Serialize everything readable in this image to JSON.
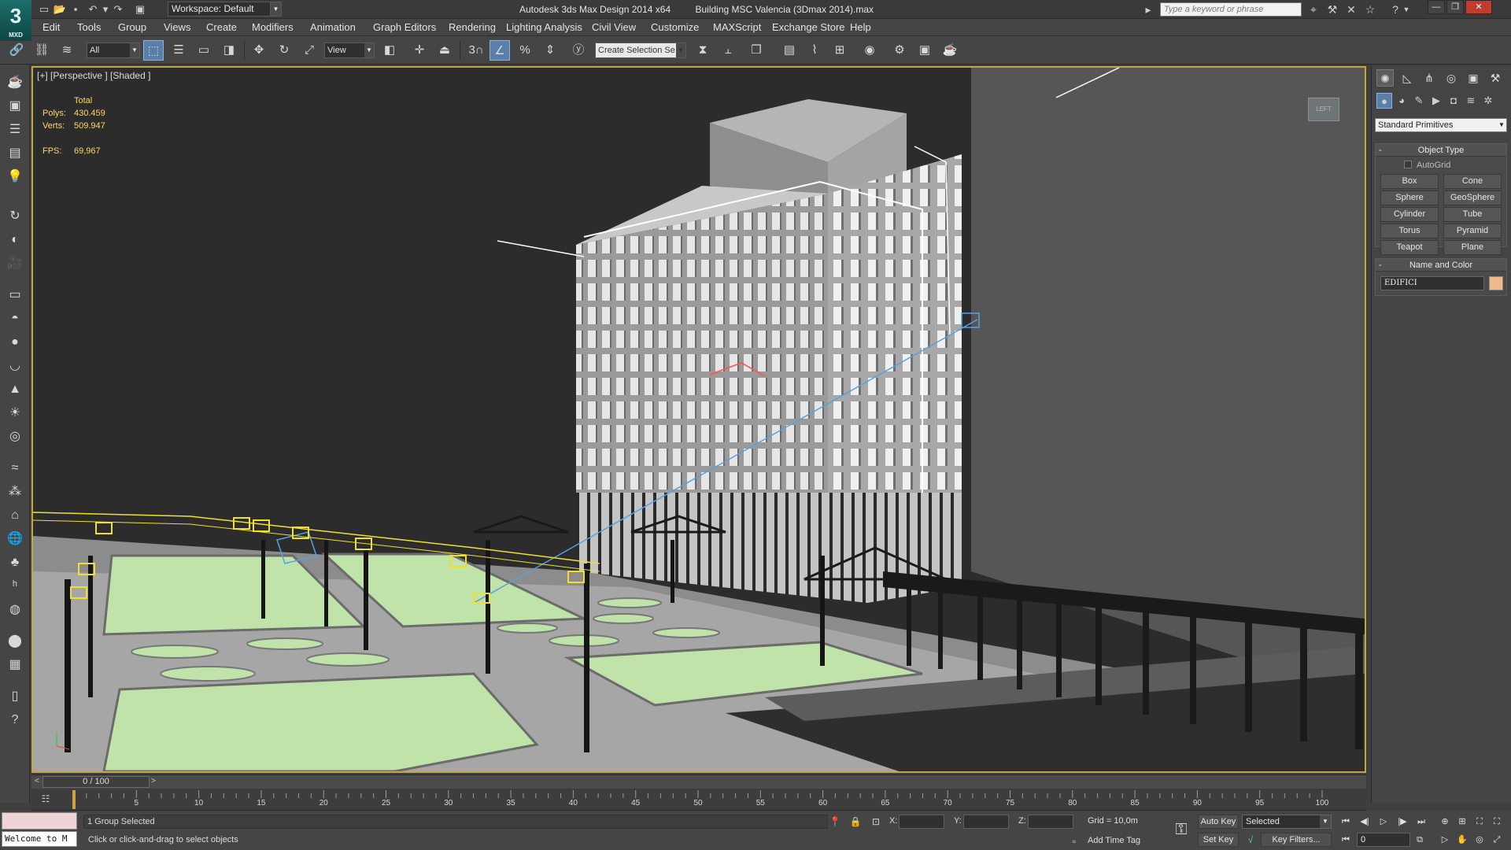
{
  "app": {
    "logo_text": "MXD",
    "window_title": "Autodesk 3ds Max Design 2014 x64",
    "file_title": "Building MSC Valencia (3Dmax 2014).max",
    "workspace": "Workspace: Default",
    "search_placeholder": "Type a keyword or phrase"
  },
  "menu": [
    "Edit",
    "Tools",
    "Group",
    "Views",
    "Create",
    "Modifiers",
    "Animation",
    "Graph Editors",
    "Rendering",
    "Lighting Analysis",
    "Civil View",
    "Customize",
    "MAXScript",
    "Exchange Store",
    "Help"
  ],
  "toolbar": {
    "selection_filter": "All",
    "ref_coord": "View",
    "snap_label": "3",
    "named_selection": "Create Selection Se"
  },
  "viewport": {
    "label": "[+] [Perspective ] [Shaded ]",
    "stats_header": "Total",
    "polys_label": "Polys:",
    "polys_value": "430.459",
    "verts_label": "Verts:",
    "verts_value": "509.947",
    "fps_label": "FPS:",
    "fps_value": "69,967",
    "viewcube_text": "LEFT"
  },
  "command_panel": {
    "category": "Standard Primitives",
    "object_type_title": "Object Type",
    "autogrid": "AutoGrid",
    "primitives": [
      "Box",
      "Cone",
      "Sphere",
      "GeoSphere",
      "Cylinder",
      "Tube",
      "Torus",
      "Pyramid",
      "Teapot",
      "Plane"
    ],
    "name_color_title": "Name and Color",
    "object_name": "EDIFICI",
    "object_color": "#f2b98a"
  },
  "timeline": {
    "frame_display": "0 / 100",
    "prev": "<",
    "next": ">",
    "ticks": [
      0,
      5,
      10,
      15,
      20,
      25,
      30,
      35,
      40,
      45,
      50,
      55,
      60,
      65,
      70,
      75,
      80,
      85,
      90,
      95,
      100
    ]
  },
  "status": {
    "welcome": "Welcome to M",
    "selection_info": "1 Group Selected",
    "prompt": "Click or click-and-drag to select objects",
    "x_label": "X:",
    "y_label": "Y:",
    "z_label": "Z:",
    "grid": "Grid = 10,0m",
    "add_time_tag": "Add Time Tag",
    "auto_key": "Auto Key",
    "set_key": "Set Key",
    "key_mode": "Selected",
    "key_filters": "Key Filters...",
    "current_frame": "0"
  },
  "colors": {
    "accent_active": "#5a7fa8",
    "viewport_border": "#c9a63c",
    "lawn": "#bfe3a8",
    "pavement": "#a9a9a9",
    "building": "#9a9a9a",
    "helpers": "#f0e02c",
    "camera_line": "#5aa0e0"
  }
}
